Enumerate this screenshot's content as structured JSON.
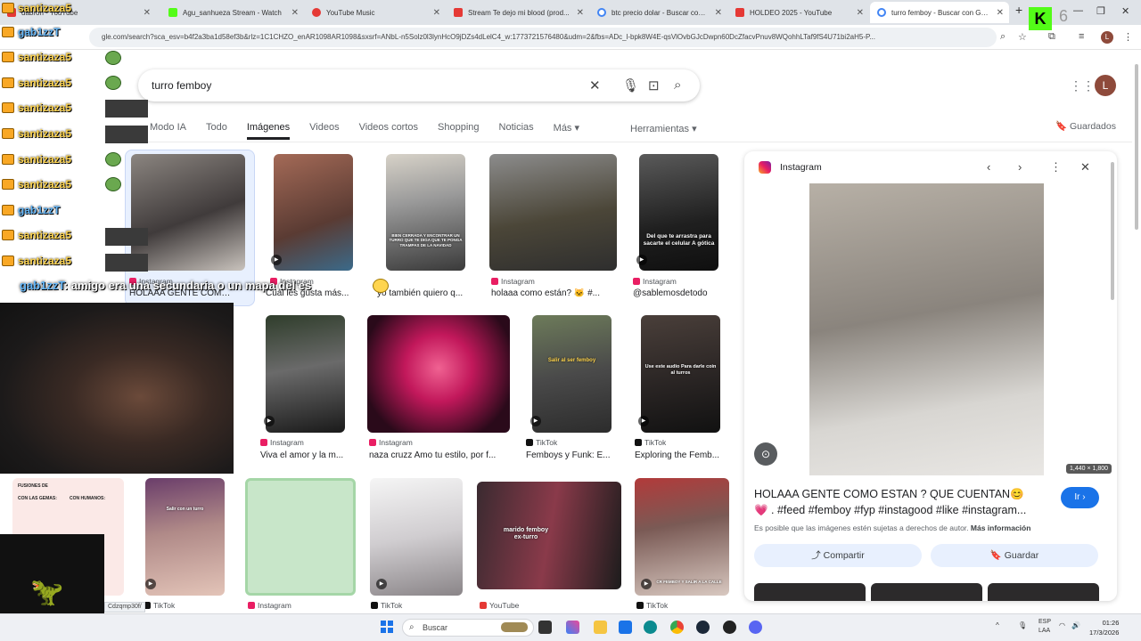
{
  "browser": {
    "tabs": [
      {
        "label": "dabron - YouTube",
        "color": "#e53935"
      },
      {
        "label": "Agu_sanhueza Stream - Watch",
        "color": "#53fc18"
      },
      {
        "label": "YouTube Music",
        "color": "#e53935"
      },
      {
        "label": "Stream Te dejo mi blood (prod...",
        "color": "#e53935"
      },
      {
        "label": "btc precio dolar - Buscar con G...",
        "color": "#4285f4"
      },
      {
        "label": "HOLDEO 2025 - YouTube",
        "color": "#e53935"
      },
      {
        "label": "turro femboy - Buscar con Goo...",
        "color": "#4285f4"
      }
    ],
    "new_tab": "+",
    "url": "gle.com/search?sca_esv=b4f2a3ba1d58ef3b&rlz=1C1CHZO_enAR1098AR1098&sxsrf=ANbL-n5Solz0l3lynHcO9jDZs4dLelC4_w:1773721576480&udm=2&fbs=ADc_l-bpk8W4E-qsVlOvbGJcDwpn60DcZfacvPnuv8WQohhLTaf9fS4U71bi2aH5-P...",
    "profile_initial": "L",
    "status_url": "Cdzqmp30f/"
  },
  "search": {
    "query": "turro femboy",
    "profile_initial": "L",
    "tabs": [
      "Modo IA",
      "Todo",
      "Imágenes",
      "Videos",
      "Videos cortos",
      "Shopping",
      "Noticias",
      "Más"
    ],
    "tools": "Herramientas",
    "saved": "Guardados"
  },
  "results": {
    "row1": [
      {
        "source": "Instagram",
        "caption": "HOLAAA GENTE COMO..."
      },
      {
        "source": "Instagram",
        "caption": "Cuál les gusta más..."
      },
      {
        "source": "",
        "caption": "yo también quiero q..."
      },
      {
        "source": "Instagram",
        "caption": "holaaa como están? 🐱 #..."
      },
      {
        "source": "Instagram",
        "caption": "@sablemosdetodo"
      }
    ],
    "row1_overlays": {
      "meme": "BIEN CERRADA Y ENCONTRAR UN TURRO QUE TE DIGA QUE TE PONGA TRAMPAS DE LA NAVIDAD",
      "gothic": "Del que te arrastra para sacarte el celular A gótica"
    },
    "row2": [
      {
        "source": "Instagram",
        "caption": "Viva el amor y la m..."
      },
      {
        "source": "Instagram",
        "caption": "naza cruzz Amo tu estilo, por f..."
      },
      {
        "source": "TikTok",
        "caption": "Femboys y Funk: E..."
      },
      {
        "source": "TikTok",
        "caption": "Exploring the Femb..."
      }
    ],
    "row2_overlays": {
      "femboy": "Salir al ser femboy",
      "audio": "Use este audio Para darle coin al turros"
    },
    "row3": [
      {
        "source": "TikTok",
        "caption": ""
      },
      {
        "source": "Instagram",
        "caption": ""
      },
      {
        "source": "TikTok",
        "caption": ""
      },
      {
        "source": "YouTube",
        "caption": ""
      },
      {
        "source": "TikTok",
        "caption": ""
      }
    ],
    "row3_overlays": {
      "fusions_a": "FUSIONES DE",
      "fusions_b": "CON LAS GEMAS:",
      "fusions_c": "CON HUMANOS:",
      "salir": "Salir con un turro",
      "marido": "marido femboy ex-turro",
      "cr": "CR FEMBOY Y SALIR A LA CALLE"
    }
  },
  "preview": {
    "source": "Instagram",
    "dims": "1,440 × 1,800",
    "title": "HOLAAA GENTE COMO ESTAN ? QUE CUENTAN😊 💗 . #feed #femboy #fyp #instagood #like #instagram...",
    "go": "Ir",
    "note": "Es posible que las imágenes estén sujetas a derechos de autor.",
    "more": "Más información",
    "share": "Compartir",
    "save": "Guardar"
  },
  "stream": {
    "chat": [
      {
        "user": "santizaza5",
        "color": "gold"
      },
      {
        "user": "gab1zzT",
        "color": "blue"
      },
      {
        "user": "santizaza5",
        "color": "gold"
      },
      {
        "user": "santizaza5",
        "color": "gold"
      },
      {
        "user": "santizaza5",
        "color": "gold"
      },
      {
        "user": "santizaza5",
        "color": "gold"
      },
      {
        "user": "santizaza5",
        "color": "gold"
      },
      {
        "user": "santizaza5",
        "color": "gold"
      },
      {
        "user": "gab1zzT",
        "color": "blue"
      },
      {
        "user": "santizaza5",
        "color": "gold"
      },
      {
        "user": "santizaza5",
        "color": "gold"
      }
    ],
    "subtitle_user": "gab1zzT",
    "subtitle_text": ": amigo era una secundaria o un mapa del es",
    "kick_number": "6"
  },
  "taskbar": {
    "search": "Buscar",
    "lang": "ESP",
    "region": "LAA",
    "time": "01:26",
    "date": "17/3/2026"
  }
}
